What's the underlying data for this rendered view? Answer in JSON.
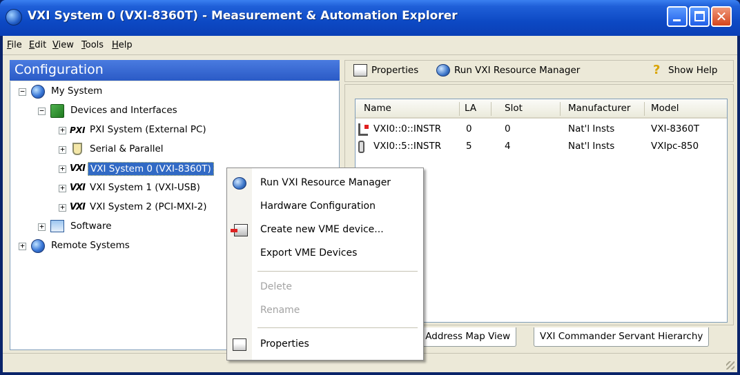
{
  "window": {
    "title": "VXI System 0 (VXI-8360T) - Measurement & Automation Explorer",
    "close_glyph": "✕"
  },
  "menu": [
    "File",
    "Edit",
    "View",
    "Tools",
    "Help"
  ],
  "left_panel": {
    "header": "Configuration",
    "tree": {
      "my_system": "My System",
      "devices_interfaces": "Devices and Interfaces",
      "pxi_system": "PXI System (External PC)",
      "serial_parallel": "Serial & Parallel",
      "vxi_system_0": "VXI System 0 (VXI-8360T)",
      "vxi_system_1": "VXI System 1 (VXI-USB)",
      "vxi_system_2": "VXI System 2 (PCI-MXI-2)",
      "software": "Software",
      "remote_systems": "Remote Systems",
      "pxi_mark": "PXI",
      "vxi_mark": "VXI"
    }
  },
  "toolbar": {
    "properties": "Properties",
    "run_resource_manager": "Run VXI Resource Manager",
    "show_help": "Show Help",
    "help_glyph": "?"
  },
  "device_list": {
    "columns": [
      "Name",
      "LA",
      "Slot",
      "Manufacturer",
      "Model"
    ],
    "rows": [
      [
        "VXI0::0::INSTR",
        "0",
        "0",
        "Nat'l Insts",
        "VXI-8360T"
      ],
      [
        "VXI0::5::INSTR",
        "5",
        "4",
        "Nat'l Insts",
        "VXIpc-850"
      ]
    ]
  },
  "tabs": [
    "I Address Map View",
    "VXI Commander Servant Hierarchy"
  ],
  "context_menu": {
    "run_rm": "Run VXI Resource Manager",
    "hw_config": "Hardware Configuration",
    "create_vme": "Create new VME device...",
    "export_vme": "Export VME Devices",
    "delete": "Delete",
    "rename": "Rename",
    "properties": "Properties"
  }
}
